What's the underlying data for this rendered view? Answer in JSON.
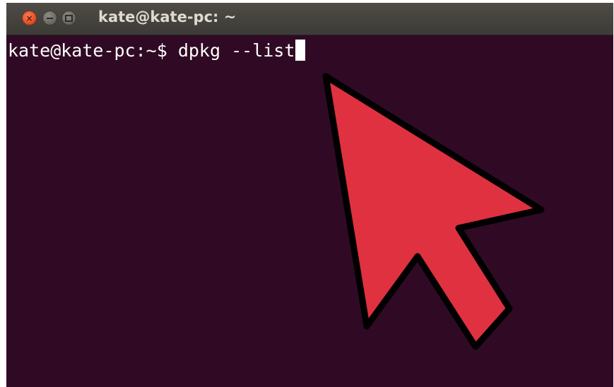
{
  "window": {
    "title": "kate@kate-pc: ~",
    "buttons": {
      "close_glyph": "×"
    }
  },
  "terminal": {
    "prompt": "kate@kate-pc:~$",
    "command": " dpkg --list"
  },
  "colors": {
    "terminal_bg": "#300a24",
    "titlebar_bg": "#3d3b37",
    "close_button": "#e0522a",
    "pointer_fill": "#e03140",
    "pointer_outline": "#000000"
  },
  "icons": {
    "close": "close-icon",
    "minimize": "minimize-icon",
    "maximize": "maximize-icon",
    "pointer": "pointer-arrow-icon"
  }
}
